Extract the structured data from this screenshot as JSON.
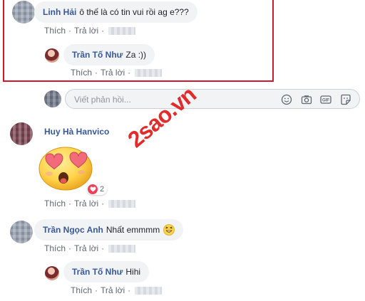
{
  "comments": [
    {
      "name": "Linh Hải",
      "text": "ô thế là có tin vui rồi ag e???"
    },
    {
      "name": "Huy Hà Hanvico",
      "text": "",
      "reaction_count": "2"
    },
    {
      "name": "Trần Ngọc Anh",
      "text": "Nhất emmmm"
    }
  ],
  "replies": [
    {
      "name": "Trần Tố Như",
      "text": "Za :))"
    },
    {
      "name": "Trần Tố Như",
      "text": "Hihi"
    }
  ],
  "actions": {
    "like": "Thích",
    "reply": "Trả lời",
    "separator": "·"
  },
  "reply_box": {
    "placeholder": "Viết phản hồi..."
  },
  "watermark": "2sao.vn",
  "highlight_color": "#d1172b",
  "icons": [
    "emoji-icon",
    "camera-icon",
    "gif-icon",
    "sticker-icon",
    "laughing-emoji-icon",
    "heart-eyes-sticker",
    "love-reaction-icon"
  ]
}
